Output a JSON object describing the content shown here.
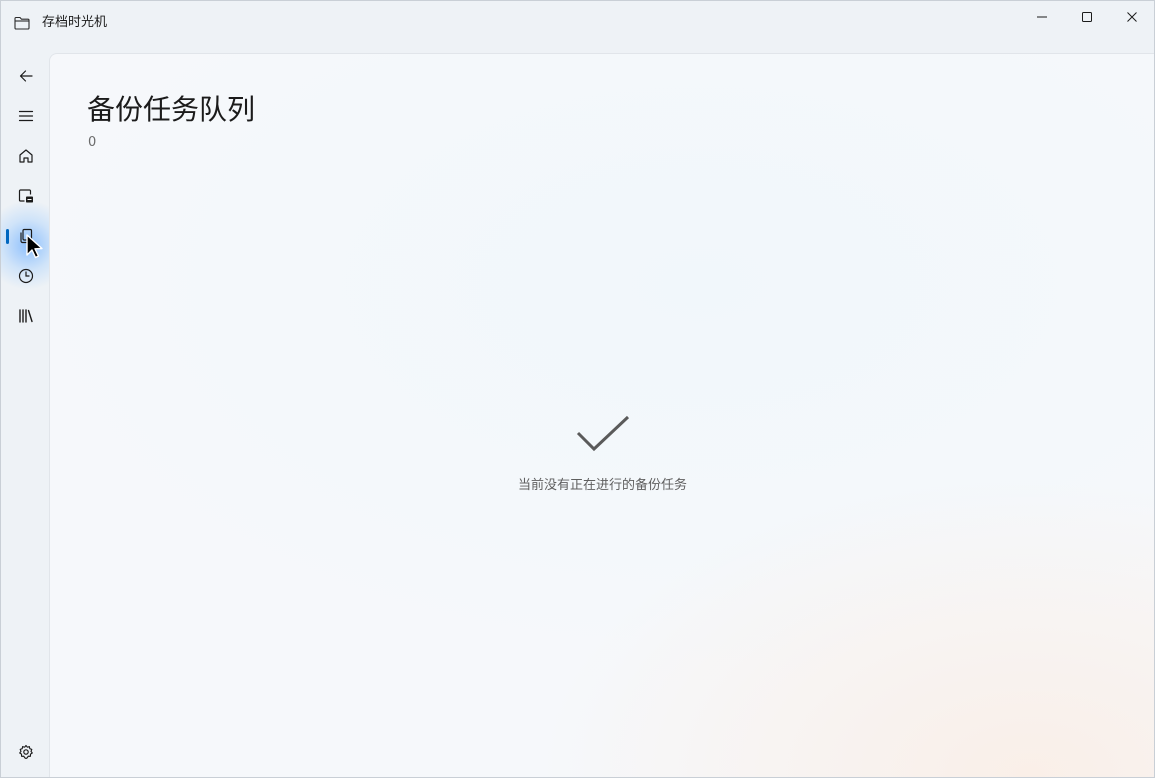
{
  "window": {
    "title": "存档时光机",
    "app_icon": "folder-icon",
    "controls": {
      "minimize_icon": "minimize-icon",
      "maximize_icon": "maximize-icon",
      "close_icon": "close-icon"
    }
  },
  "nav": {
    "back_icon": "arrow-left-icon",
    "menu_icon": "hamburger-icon",
    "items": [
      {
        "id": "home",
        "icon": "home-icon",
        "selected": false
      },
      {
        "id": "backup",
        "icon": "backup-icon",
        "selected": false
      },
      {
        "id": "queue",
        "icon": "copy-icon",
        "selected": true
      },
      {
        "id": "history",
        "icon": "clock-icon",
        "selected": false
      },
      {
        "id": "library",
        "icon": "library-icon",
        "selected": false
      }
    ],
    "settings_icon": "gear-icon"
  },
  "page": {
    "title": "备份任务队列",
    "count": "0",
    "empty_icon": "checkmark-icon",
    "empty_message": "当前没有正在进行的备份任务"
  },
  "colors": {
    "accent": "#0067c0",
    "background": "#f6f8fb",
    "chrome": "#eef2f6"
  }
}
